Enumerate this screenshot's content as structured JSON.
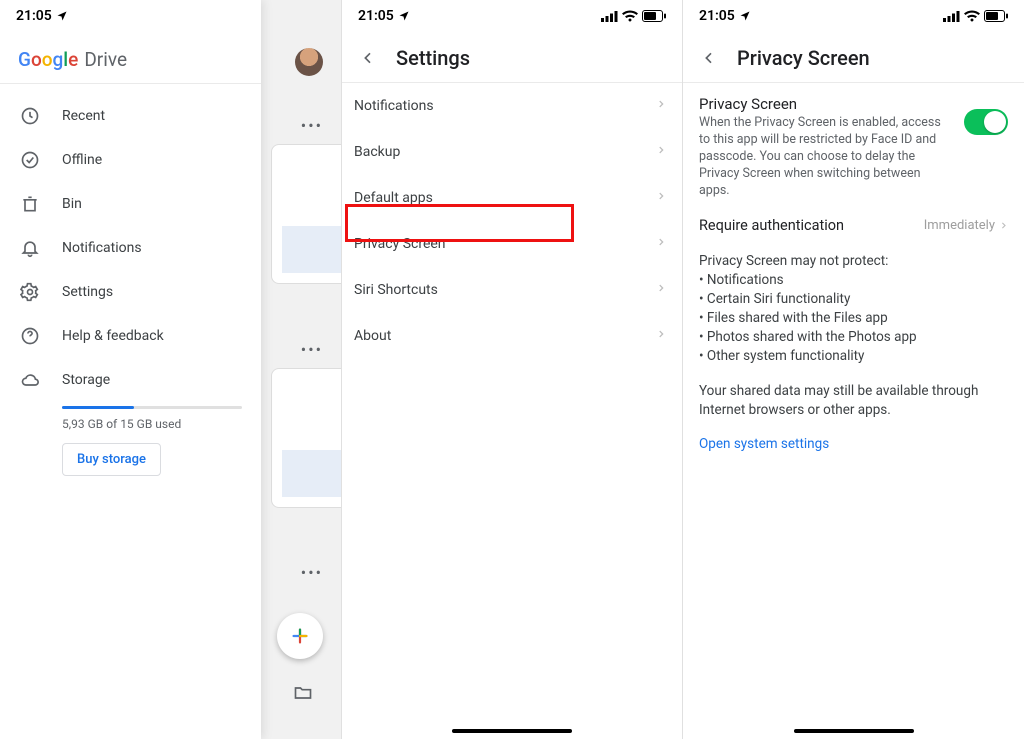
{
  "status": {
    "time": "21:05"
  },
  "phoneA": {
    "brand_google": "Google",
    "brand_drive": "Drive",
    "menu": {
      "recent": "Recent",
      "offline": "Offline",
      "bin": "Bin",
      "notifications": "Notifications",
      "settings": "Settings",
      "help": "Help & feedback",
      "storage": "Storage"
    },
    "storage_text": "5,93 GB of 15 GB used",
    "buy_label": "Buy storage"
  },
  "phoneB": {
    "title": "Settings",
    "rows": {
      "notifications": "Notifications",
      "backup": "Backup",
      "default_apps": "Default apps",
      "privacy_screen": "Privacy Screen",
      "siri": "Siri Shortcuts",
      "about": "About"
    }
  },
  "phoneC": {
    "title": "Privacy Screen",
    "ps_title": "Privacy Screen",
    "ps_sub": "When the Privacy Screen is enabled, access to this app will be restricted by Face ID and passcode. You can choose to delay the Privacy Screen when switching between apps.",
    "require_label": "Require authentication",
    "require_value": "Immediately",
    "warn_intro": "Privacy Screen may not protect:",
    "warn_items": {
      "a": "Notifications",
      "b": "Certain Siri functionality",
      "c": "Files shared with the Files app",
      "d": "Photos shared with the Photos app",
      "e": "Other system functionality"
    },
    "shared_note": "Your shared data may still be available through Internet browsers or other apps.",
    "link": "Open system settings"
  }
}
